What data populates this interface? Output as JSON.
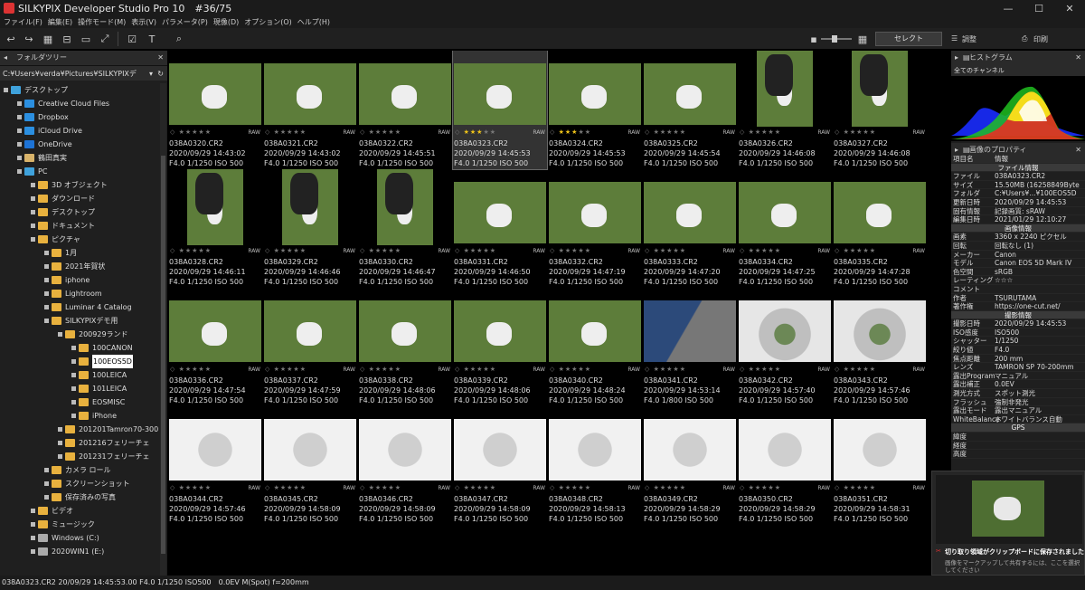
{
  "window": {
    "title": "SILKYPIX Developer Studio Pro 10　#36/75",
    "controls": [
      "—",
      "☐",
      "✕"
    ]
  },
  "menu": [
    "ファイル(F)",
    "編集(E)",
    "操作モード(M)",
    "表示(V)",
    "パラメータ(P)",
    "現像(D)",
    "オプション(O)",
    "ヘルプ(H)"
  ],
  "toolbar": {
    "select_label": "セレクト",
    "adjust_label": "調整",
    "print_label": "印刷"
  },
  "left_panel": {
    "title": "フォルダツリー",
    "path": "C:¥Users¥verda¥Pictures¥SILKYPIXデ",
    "tree": [
      {
        "label": "デスクトップ",
        "icon": "pc"
      },
      {
        "label": "Creative Cloud Files",
        "icon": "cloud"
      },
      {
        "label": "Dropbox",
        "icon": "cloud"
      },
      {
        "label": "iCloud Drive",
        "icon": "cloud"
      },
      {
        "label": "OneDrive",
        "icon": "onedrive"
      },
      {
        "label": "鶴田真実",
        "icon": "user"
      },
      {
        "label": "PC",
        "icon": "pc"
      },
      {
        "label": "3D オブジェクト",
        "icon": "folder"
      },
      {
        "label": "ダウンロード",
        "icon": "folder"
      },
      {
        "label": "デスクトップ",
        "icon": "folder"
      },
      {
        "label": "ドキュメント",
        "icon": "folder"
      },
      {
        "label": "ピクチャ",
        "icon": "folder"
      },
      {
        "label": "1月",
        "icon": "folder"
      },
      {
        "label": "2021年賀状",
        "icon": "folder"
      },
      {
        "label": "iphone",
        "icon": "folder"
      },
      {
        "label": "Lightroom",
        "icon": "folder"
      },
      {
        "label": "Luminar 4 Catalog",
        "icon": "folder"
      },
      {
        "label": "SILKYPIXデモ用",
        "icon": "folder"
      },
      {
        "label": "200929ランド",
        "icon": "folder"
      },
      {
        "label": "100CANON",
        "icon": "folder"
      },
      {
        "label": "100EOS5D",
        "icon": "folder"
      },
      {
        "label": "100LEICA",
        "icon": "folder"
      },
      {
        "label": "101LEICA",
        "icon": "folder"
      },
      {
        "label": "EOSMISC",
        "icon": "folder"
      },
      {
        "label": "iPhone",
        "icon": "folder"
      },
      {
        "label": "201201Tamron70-300",
        "icon": "folder"
      },
      {
        "label": "201216フェリーチェ",
        "icon": "folder"
      },
      {
        "label": "201231フェリーチェ",
        "icon": "folder"
      },
      {
        "label": "カメラ ロール",
        "icon": "folder"
      },
      {
        "label": "スクリーンショット",
        "icon": "folder"
      },
      {
        "label": "保存済みの写真",
        "icon": "folder"
      },
      {
        "label": "ビデオ",
        "icon": "folder"
      },
      {
        "label": "ミュージック",
        "icon": "folder"
      },
      {
        "label": "Windows (C:)",
        "icon": "drive"
      },
      {
        "label": "2020WIN1 (E:)",
        "icon": "drive"
      }
    ]
  },
  "thumbnails": [
    {
      "name": "038A0320.CR2",
      "date": "2020/09/29 14:43:02",
      "exif": "F4.0 1/1250 ISO 500",
      "rating": 0,
      "kind": "grass"
    },
    {
      "name": "038A0321.CR2",
      "date": "2020/09/29 14:43:02",
      "exif": "F4.0 1/1250 ISO 500",
      "rating": 0,
      "kind": "grass"
    },
    {
      "name": "038A0322.CR2",
      "date": "2020/09/29 14:45:51",
      "exif": "F4.0 1/1250 ISO 500",
      "rating": 0,
      "kind": "grass"
    },
    {
      "name": "038A0323.CR2",
      "date": "2020/09/29 14:45:53",
      "exif": "F4.0 1/1250 ISO 500",
      "rating": 3,
      "kind": "grass",
      "selected": true
    },
    {
      "name": "038A0324.CR2",
      "date": "2020/09/29 14:45:53",
      "exif": "F4.0 1/1250 ISO 500",
      "rating": 3,
      "kind": "grass"
    },
    {
      "name": "038A0325.CR2",
      "date": "2020/09/29 14:45:54",
      "exif": "F4.0 1/1250 ISO 500",
      "rating": 0,
      "kind": "grass"
    },
    {
      "name": "038A0326.CR2",
      "date": "2020/09/29 14:46:08",
      "exif": "F4.0 1/1250 ISO 500",
      "rating": 0,
      "kind": "portrait"
    },
    {
      "name": "038A0327.CR2",
      "date": "2020/09/29 14:46:08",
      "exif": "F4.0 1/1250 ISO 500",
      "rating": 0,
      "kind": "portrait"
    },
    {
      "name": "038A0328.CR2",
      "date": "2020/09/29 14:46:11",
      "exif": "F4.0 1/1250 ISO 500",
      "rating": 0,
      "kind": "portrait"
    },
    {
      "name": "038A0329.CR2",
      "date": "2020/09/29 14:46:46",
      "exif": "F4.0 1/1250 ISO 500",
      "rating": 0,
      "kind": "portrait"
    },
    {
      "name": "038A0330.CR2",
      "date": "2020/09/29 14:46:47",
      "exif": "F4.0 1/1250 ISO 500",
      "rating": 0,
      "kind": "portrait"
    },
    {
      "name": "038A0331.CR2",
      "date": "2020/09/29 14:46:50",
      "exif": "F4.0 1/1250 ISO 500",
      "rating": 0,
      "kind": "grass"
    },
    {
      "name": "038A0332.CR2",
      "date": "2020/09/29 14:47:19",
      "exif": "F4.0 1/1250 ISO 500",
      "rating": 0,
      "kind": "grass"
    },
    {
      "name": "038A0333.CR2",
      "date": "2020/09/29 14:47:20",
      "exif": "F4.0 1/1250 ISO 500",
      "rating": 0,
      "kind": "grass"
    },
    {
      "name": "038A0334.CR2",
      "date": "2020/09/29 14:47:25",
      "exif": "F4.0 1/1250 ISO 500",
      "rating": 0,
      "kind": "grass"
    },
    {
      "name": "038A0335.CR2",
      "date": "2020/09/29 14:47:28",
      "exif": "F4.0 1/1250 ISO 500",
      "rating": 0,
      "kind": "grass"
    },
    {
      "name": "038A0336.CR2",
      "date": "2020/09/29 14:47:54",
      "exif": "F4.0 1/1250 ISO 500",
      "rating": 0,
      "kind": "grass"
    },
    {
      "name": "038A0337.CR2",
      "date": "2020/09/29 14:47:59",
      "exif": "F4.0 1/1250 ISO 500",
      "rating": 0,
      "kind": "grass"
    },
    {
      "name": "038A0338.CR2",
      "date": "2020/09/29 14:48:06",
      "exif": "F4.0 1/1250 ISO 500",
      "rating": 0,
      "kind": "grass"
    },
    {
      "name": "038A0339.CR2",
      "date": "2020/09/29 14:48:06",
      "exif": "F4.0 1/1250 ISO 500",
      "rating": 0,
      "kind": "grass"
    },
    {
      "name": "038A0340.CR2",
      "date": "2020/09/29 14:48:24",
      "exif": "F4.0 1/1250 ISO 500",
      "rating": 0,
      "kind": "grass"
    },
    {
      "name": "038A0341.CR2",
      "date": "2020/09/29 14:53:14",
      "exif": "F4.0 1/800 ISO 500",
      "rating": 0,
      "kind": "denim"
    },
    {
      "name": "038A0342.CR2",
      "date": "2020/09/29 14:57:40",
      "exif": "F4.0 1/1250 ISO 500",
      "rating": 0,
      "kind": "tube"
    },
    {
      "name": "038A0343.CR2",
      "date": "2020/09/29 14:57:46",
      "exif": "F4.0 1/1250 ISO 500",
      "rating": 0,
      "kind": "tube"
    },
    {
      "name": "038A0344.CR2",
      "date": "2020/09/29 14:57:46",
      "exif": "F4.0 1/1250 ISO 500",
      "rating": 0,
      "kind": "tube2"
    },
    {
      "name": "038A0345.CR2",
      "date": "2020/09/29 14:58:09",
      "exif": "F4.0 1/1250 ISO 500",
      "rating": 0,
      "kind": "tube2"
    },
    {
      "name": "038A0346.CR2",
      "date": "2020/09/29 14:58:09",
      "exif": "F4.0 1/1250 ISO 500",
      "rating": 0,
      "kind": "tube2"
    },
    {
      "name": "038A0347.CR2",
      "date": "2020/09/29 14:58:09",
      "exif": "F4.0 1/1250 ISO 500",
      "rating": 0,
      "kind": "tube2"
    },
    {
      "name": "038A0348.CR2",
      "date": "2020/09/29 14:58:13",
      "exif": "F4.0 1/1250 ISO 500",
      "rating": 0,
      "kind": "tube2"
    },
    {
      "name": "038A0349.CR2",
      "date": "2020/09/29 14:58:29",
      "exif": "F4.0 1/1250 ISO 500",
      "rating": 0,
      "kind": "tube2"
    },
    {
      "name": "038A0350.CR2",
      "date": "2020/09/29 14:58:29",
      "exif": "F4.0 1/1250 ISO 500",
      "rating": 0,
      "kind": "tube2"
    },
    {
      "name": "038A0351.CR2",
      "date": "2020/09/29 14:58:31",
      "exif": "F4.0 1/1250 ISO 500",
      "rating": 0,
      "kind": "tube2"
    }
  ],
  "right_panel": {
    "histogram_title": "ヒストグラム",
    "channel": "全てのチャンネル",
    "props_title": "画像のプロパティ",
    "rows": [
      {
        "k": "項目名",
        "v": "情報",
        "type": "hdr"
      },
      {
        "k": "",
        "v": "ファイル情報",
        "type": "sec"
      },
      {
        "k": "ファイル",
        "v": "038A0323.CR2"
      },
      {
        "k": "サイズ",
        "v": "15.50MB (16258849Byte"
      },
      {
        "k": "フォルダ",
        "v": "C:¥Users¥...¥100EOS5D"
      },
      {
        "k": "更新日時",
        "v": "2020/09/29 14:45:53"
      },
      {
        "k": "固有情報",
        "v": "記録画質: sRAW"
      },
      {
        "k": "編集日時",
        "v": "2021/01/29 12:10:27"
      },
      {
        "k": "",
        "v": "画像情報",
        "type": "sec"
      },
      {
        "k": "画素",
        "v": "3360 x 2240 ピクセル"
      },
      {
        "k": "回転",
        "v": "回転なし (1)"
      },
      {
        "k": "メーカー",
        "v": "Canon"
      },
      {
        "k": "モデル",
        "v": "Canon EOS 5D Mark IV"
      },
      {
        "k": "色空間",
        "v": "sRGB"
      },
      {
        "k": "レーティング",
        "v": "☆☆☆"
      },
      {
        "k": "コメント",
        "v": ""
      },
      {
        "k": "作者",
        "v": "TSURUTAMA"
      },
      {
        "k": "著作権",
        "v": "https://one-cut.net/"
      },
      {
        "k": "",
        "v": "撮影情報",
        "type": "sec"
      },
      {
        "k": "撮影日時",
        "v": "2020/09/29 14:45:53"
      },
      {
        "k": "ISO感度",
        "v": "ISO500"
      },
      {
        "k": "シャッター",
        "v": "1/1250"
      },
      {
        "k": "絞り値",
        "v": "F4.0"
      },
      {
        "k": "焦点距離",
        "v": "200 mm"
      },
      {
        "k": "レンズ",
        "v": "TAMRON SP 70-200mm"
      },
      {
        "k": "露出Program",
        "v": "マニュアル"
      },
      {
        "k": "露出補正",
        "v": "0.0EV"
      },
      {
        "k": "測光方式",
        "v": "スポット測光"
      },
      {
        "k": "フラッシュ",
        "v": "強制非発光"
      },
      {
        "k": "露出モード",
        "v": "露出マニュアル"
      },
      {
        "k": "WhiteBalance",
        "v": "ホワイトバランス自動"
      },
      {
        "k": "",
        "v": "GPS",
        "type": "sec"
      },
      {
        "k": "緯度",
        "v": ""
      },
      {
        "k": "経度",
        "v": ""
      },
      {
        "k": "高度",
        "v": ""
      }
    ]
  },
  "notification": {
    "title": "切り取り領域がクリップボードに保存されました",
    "body": "画像をマークアップして共有するには、ここを選択してください"
  },
  "status": "038A0323.CR2 20/09/29 14:45:53.00 F4.0 1/1250 ISO500　0.0EV M(Spot) f=200mm",
  "colors": {
    "bg": "#000000",
    "panel": "#1f1f1f",
    "star": "#f0c419",
    "folder": "#e8b13e",
    "grass": "#5d7d3a"
  }
}
